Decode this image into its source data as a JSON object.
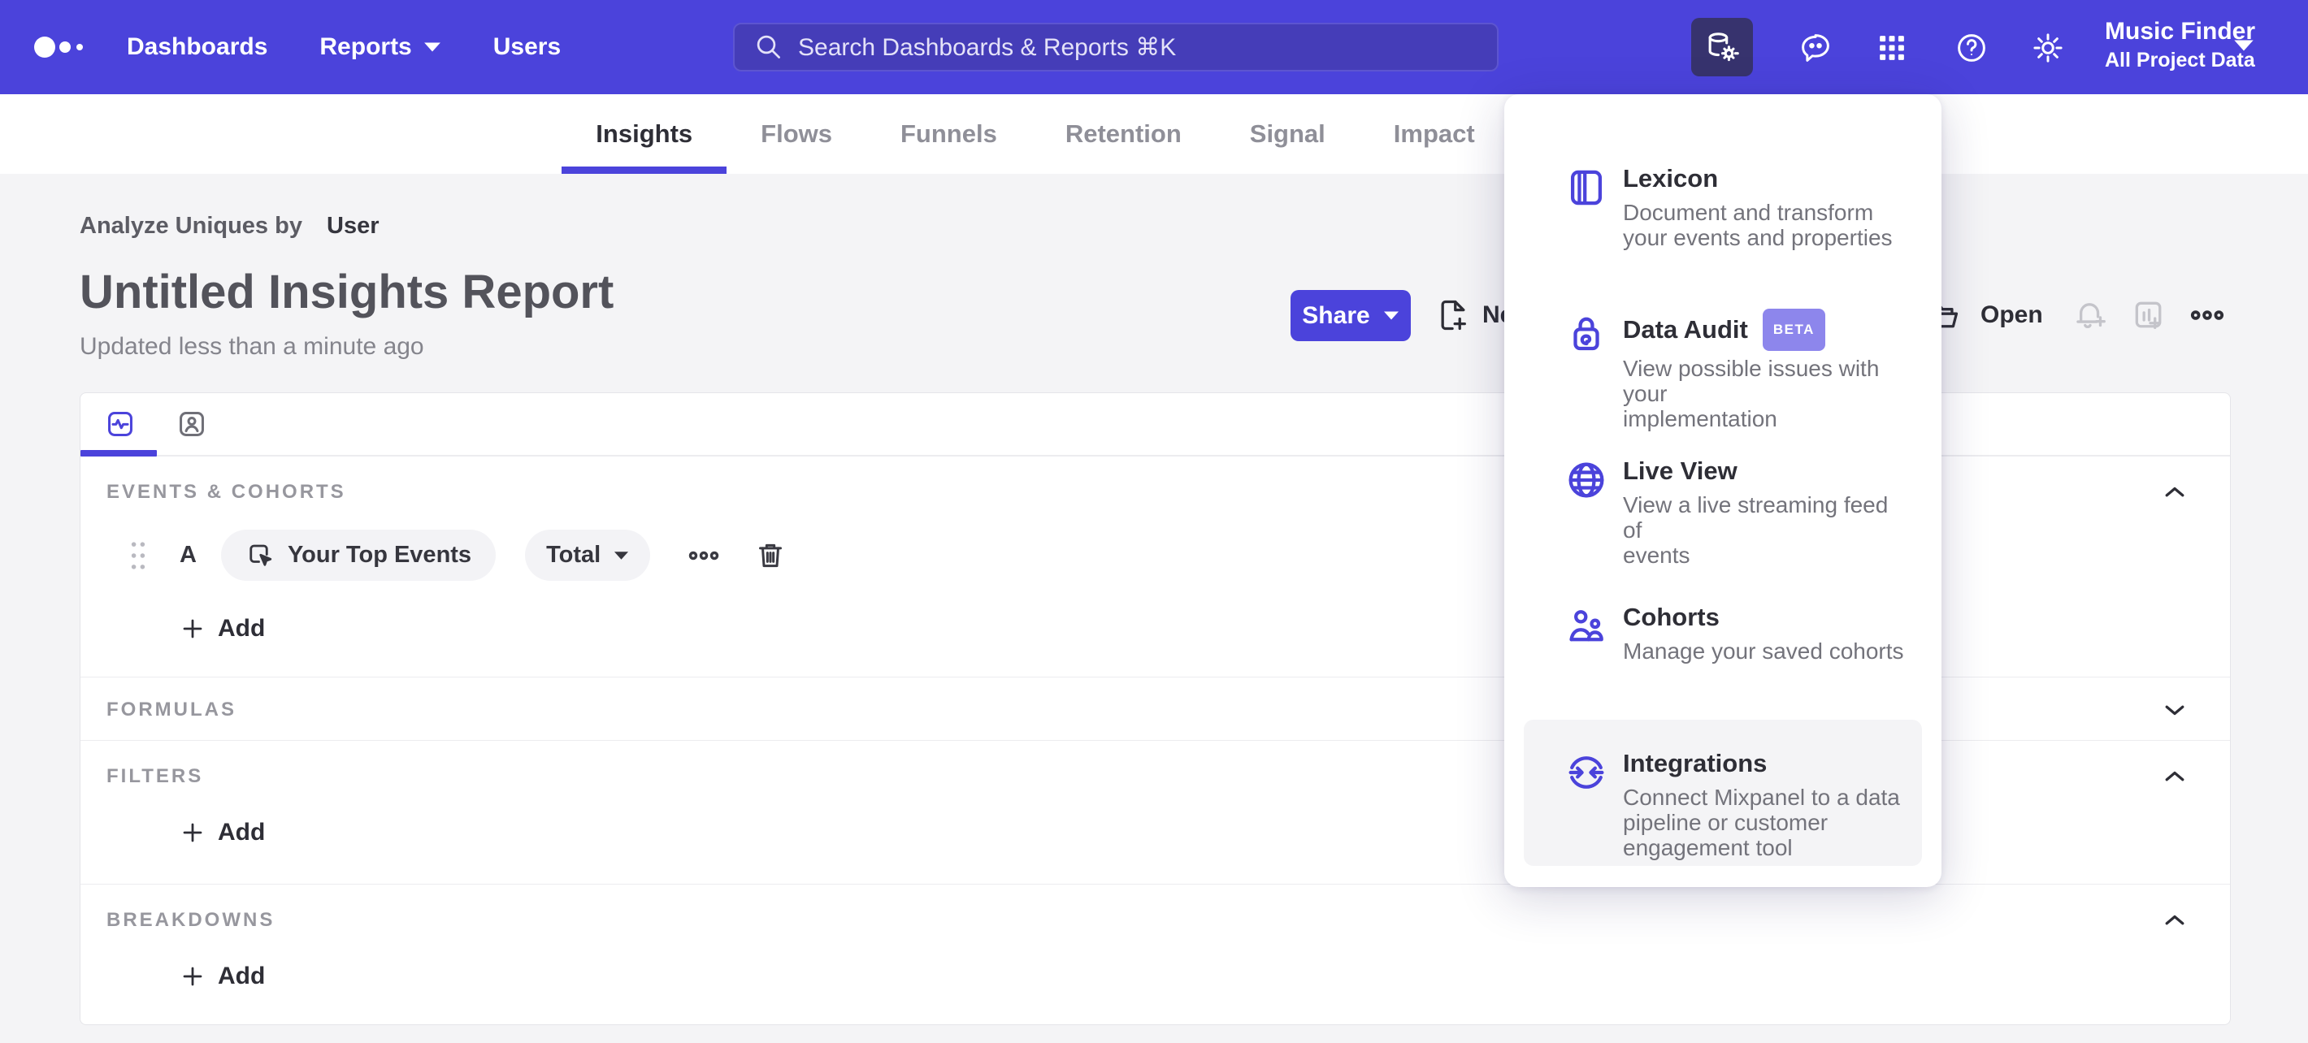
{
  "colors": {
    "brand": "#4B43DB",
    "nav_background": "#4B43DB",
    "nav_active_tile": "#37336E",
    "search_field": "#453DB8",
    "beta_badge": "#8D86EC",
    "menu_highlight": "#F4F4F6",
    "page_background": "#F4F4F6"
  },
  "topnav": {
    "links": [
      {
        "label": "Dashboards"
      },
      {
        "label": "Reports"
      },
      {
        "label": "Users"
      }
    ],
    "search_placeholder": "Search Dashboards & Reports ⌘K",
    "project": {
      "name": "Music Finder",
      "scope": "All Project Data"
    }
  },
  "report_tabs": [
    {
      "label": "Insights",
      "active": true
    },
    {
      "label": "Flows",
      "active": false
    },
    {
      "label": "Funnels",
      "active": false
    },
    {
      "label": "Retention",
      "active": false
    },
    {
      "label": "Signal",
      "active": false
    },
    {
      "label": "Impact",
      "active": false
    }
  ],
  "report": {
    "context_label": "Analyze Uniques by",
    "context_value": "User",
    "title": "Untitled Insights Report",
    "updated": "Updated less than a minute ago",
    "share_label": "Share",
    "new_label": "New",
    "open_label": "Open"
  },
  "builder": {
    "sections": {
      "events": "EVENTS & COHORTS",
      "formulas": "FORMULAS",
      "filters": "FILTERS",
      "breakdowns": "BREAKDOWNS"
    },
    "event_row": {
      "letter": "A",
      "event": "Your Top Events",
      "aggregation": "Total"
    },
    "add_label": "Add"
  },
  "menu": {
    "items": [
      {
        "title": "Lexicon",
        "description": "Document and transform\nyour events and properties"
      },
      {
        "title": "Data Audit",
        "badge": "BETA",
        "description": "View possible issues with your\nimplementation"
      },
      {
        "title": "Live View",
        "description": "View a live streaming feed of\nevents"
      },
      {
        "title": "Cohorts",
        "description": "Manage your saved cohorts"
      },
      {
        "title": "Integrations",
        "description": "Connect Mixpanel to a data\npipeline or customer\nengagement tool"
      }
    ]
  }
}
